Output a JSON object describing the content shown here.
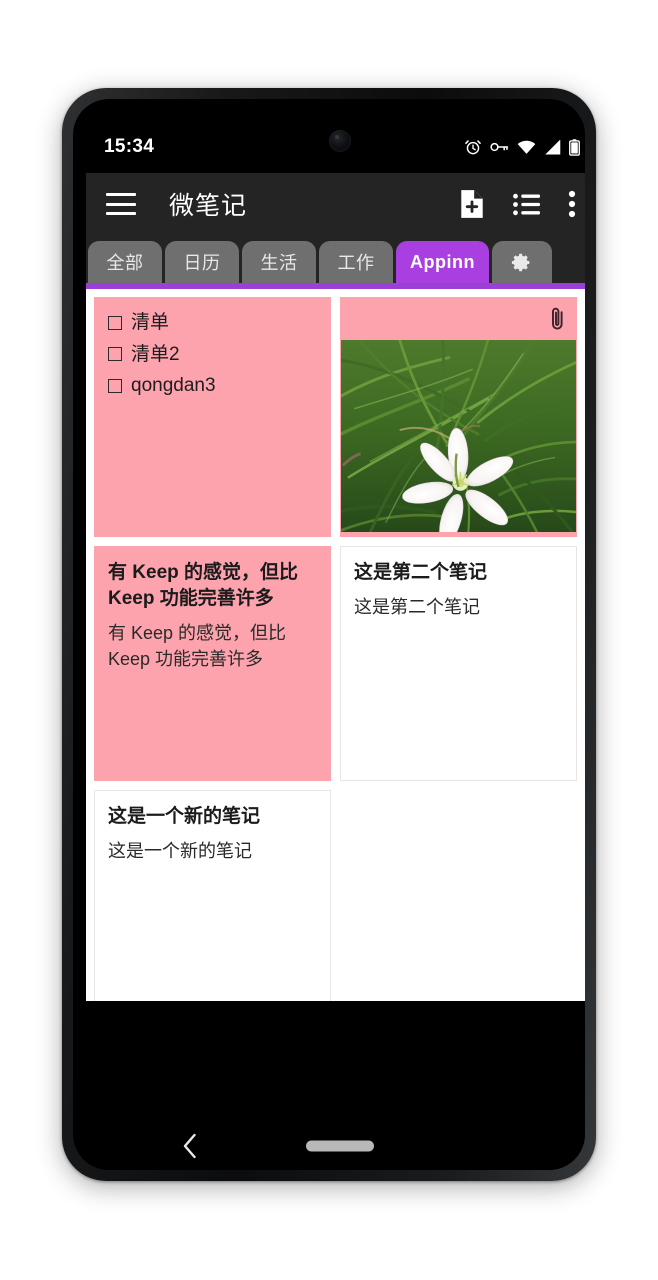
{
  "status_bar": {
    "time": "15:34",
    "icons": [
      "alarm-icon",
      "vpn-key-icon",
      "wifi-icon",
      "signal-icon",
      "battery-icon"
    ]
  },
  "app_bar": {
    "menu_icon": "hamburger-menu-icon",
    "title": "微笔记",
    "actions": [
      {
        "icon": "new-note-icon",
        "label": "新建笔记"
      },
      {
        "icon": "list-view-icon",
        "label": "列表视图"
      },
      {
        "icon": "overflow-menu-icon",
        "label": "更多"
      }
    ]
  },
  "tabs": {
    "items": [
      {
        "label": "全部",
        "active": false
      },
      {
        "label": "日历",
        "active": false
      },
      {
        "label": "生活",
        "active": false
      },
      {
        "label": "工作",
        "active": false
      },
      {
        "label": "Appinn",
        "active": true
      },
      {
        "label": "",
        "icon": "gear-icon",
        "active": false
      }
    ],
    "active_color": "#a93fe0",
    "inactive_color": "#6f6f6f",
    "underline_color": "#9b3fd6"
  },
  "notes": [
    {
      "type": "checklist",
      "color": "#fca3ae",
      "items": [
        {
          "text": "清单",
          "checked": false
        },
        {
          "text": "清单2",
          "checked": false
        },
        {
          "text": "qongdan3",
          "checked": false
        }
      ]
    },
    {
      "type": "photo",
      "color": "#fca3ae",
      "attachment_icon": "paperclip-icon",
      "image_alt": "白色花朵与草地"
    },
    {
      "type": "text",
      "color": "#fca3ae",
      "title": "有 Keep 的感觉，但比 Keep 功能完善许多",
      "body": "有 Keep 的感觉，但比 Keep 功能完善许多"
    },
    {
      "type": "text",
      "color": "#ffffff",
      "title": "这是第二个笔记",
      "body": "这是第二个笔记"
    },
    {
      "type": "text",
      "color": "#ffffff",
      "title": "这是一个新的笔记",
      "body": "这是一个新的笔记"
    }
  ],
  "nav_bar": {
    "back_icon": "back-chevron-icon",
    "home_icon": "home-pill-icon"
  }
}
